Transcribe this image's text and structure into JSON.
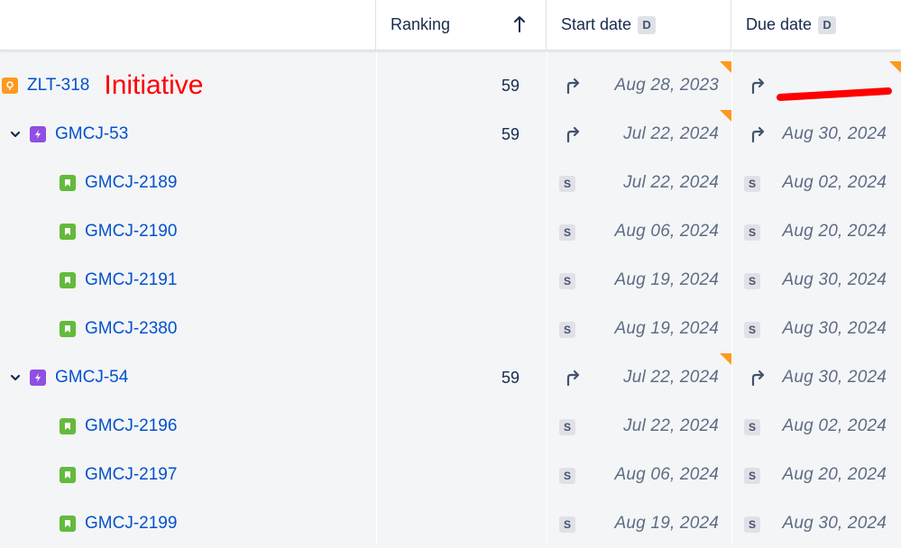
{
  "header": {
    "ranking_label": "Ranking",
    "start_label": "Start date",
    "start_badge": "D",
    "due_label": "Due date",
    "due_badge": "D"
  },
  "annotation": {
    "label": "Initiative",
    "color": "#ff0000"
  },
  "colors": {
    "link": "#0052cc",
    "initiative": "#ff991f",
    "epic": "#904ee2",
    "story": "#63ba3c",
    "flag": "#ff991f"
  },
  "rows": [
    {
      "key": "ZLT-318",
      "type": "initiative",
      "rank": "59",
      "start_icon": "rollup-arrow-icon",
      "start": "Aug 28, 2023",
      "due_icon": "rollup-arrow-icon",
      "due": ""
    },
    {
      "key": "GMCJ-53",
      "type": "epic",
      "rank": "59",
      "start_icon": "rollup-arrow-icon",
      "start": "Jul 22, 2024",
      "due_icon": "rollup-arrow-icon",
      "due": "Aug 30, 2024"
    },
    {
      "key": "GMCJ-2189",
      "type": "story",
      "rank": "",
      "start_badge": "S",
      "start": "Jul 22, 2024",
      "due_badge": "S",
      "due": "Aug 02, 2024"
    },
    {
      "key": "GMCJ-2190",
      "type": "story",
      "rank": "",
      "start_badge": "S",
      "start": "Aug 06, 2024",
      "due_badge": "S",
      "due": "Aug 20, 2024"
    },
    {
      "key": "GMCJ-2191",
      "type": "story",
      "rank": "",
      "start_badge": "S",
      "start": "Aug 19, 2024",
      "due_badge": "S",
      "due": "Aug 30, 2024"
    },
    {
      "key": "GMCJ-2380",
      "type": "story",
      "rank": "",
      "start_badge": "S",
      "start": "Aug 19, 2024",
      "due_badge": "S",
      "due": "Aug 30, 2024"
    },
    {
      "key": "GMCJ-54",
      "type": "epic",
      "rank": "59",
      "start_icon": "rollup-arrow-icon",
      "start": "Jul 22, 2024",
      "due_icon": "rollup-arrow-icon",
      "due": "Aug 30, 2024"
    },
    {
      "key": "GMCJ-2196",
      "type": "story",
      "rank": "",
      "start_badge": "S",
      "start": "Jul 22, 2024",
      "due_badge": "S",
      "due": "Aug 02, 2024"
    },
    {
      "key": "GMCJ-2197",
      "type": "story",
      "rank": "",
      "start_badge": "S",
      "start": "Aug 06, 2024",
      "due_badge": "S",
      "due": "Aug 20, 2024"
    },
    {
      "key": "GMCJ-2199",
      "type": "story",
      "rank": "",
      "start_badge": "S",
      "start": "Aug 19, 2024",
      "due_badge": "S",
      "due": "Aug 30, 2024"
    }
  ]
}
